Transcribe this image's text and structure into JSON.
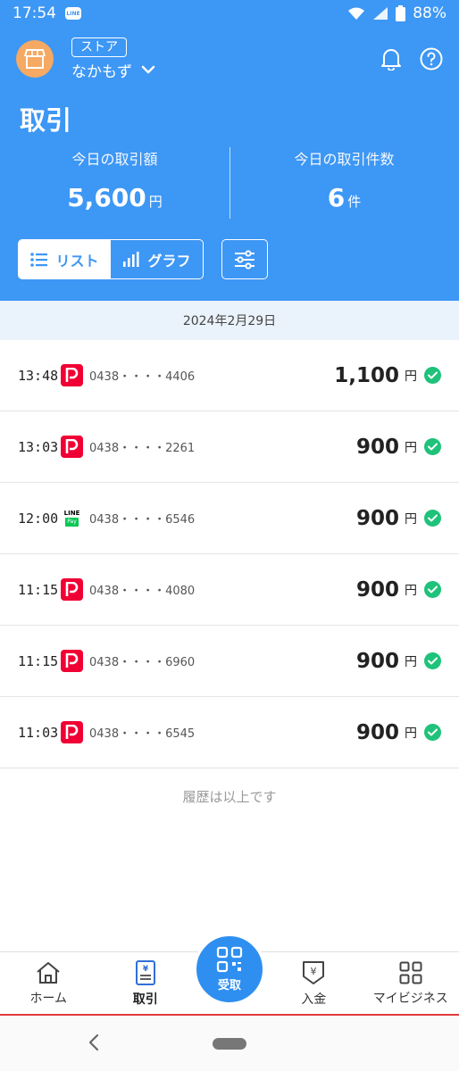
{
  "status_bar": {
    "time": "17:54",
    "line_badge": "LINE",
    "battery": "88%"
  },
  "store": {
    "tag": "ストア",
    "name": "なかもず"
  },
  "page_title": "取引",
  "stats": {
    "amount_label": "今日の取引額",
    "amount_value": "5,600",
    "amount_unit": "円",
    "count_label": "今日の取引件数",
    "count_value": "6",
    "count_unit": "件"
  },
  "view_toggle": {
    "list": "リスト",
    "graph": "グラフ"
  },
  "date_header": "2024年2月29日",
  "transactions": [
    {
      "time": "13:48",
      "method": "paypay",
      "phone": "0438・・・・4406",
      "amount": "1,100",
      "unit": "円"
    },
    {
      "time": "13:03",
      "method": "paypay",
      "phone": "0438・・・・2261",
      "amount": "900",
      "unit": "円"
    },
    {
      "time": "12:00",
      "method": "linepay",
      "phone": "0438・・・・6546",
      "amount": "900",
      "unit": "円"
    },
    {
      "time": "11:15",
      "method": "paypay",
      "phone": "0438・・・・4080",
      "amount": "900",
      "unit": "円"
    },
    {
      "time": "11:15",
      "method": "paypay",
      "phone": "0438・・・・6960",
      "amount": "900",
      "unit": "円"
    },
    {
      "time": "11:03",
      "method": "paypay",
      "phone": "0438・・・・6545",
      "amount": "900",
      "unit": "円"
    }
  ],
  "linepay_label": {
    "top": "LINE",
    "bottom": "Pay"
  },
  "end_text": "履歴は以上です",
  "bottom_nav": {
    "home": "ホーム",
    "transactions": "取引",
    "receive": "受取",
    "deposit": "入金",
    "my_business": "マイビジネス"
  },
  "colors": {
    "primary": "#3d97f5",
    "paypay_red": "#f00034",
    "success_green": "#1fc27a",
    "store_avatar": "#f5a962"
  }
}
